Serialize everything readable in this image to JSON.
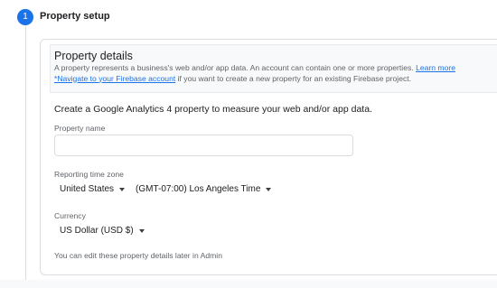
{
  "stepper": {
    "number": "1",
    "title": "Property setup"
  },
  "details": {
    "title": "Property details",
    "description": "A property represents a business's web and/or app data. An account can contain one or more properties.",
    "learn_more": "Learn more",
    "firebase_link": "*Navigate to your Firebase account",
    "firebase_text": " if you want to create a new property for an existing Firebase project."
  },
  "form": {
    "intro": "Create a Google Analytics 4 property to measure your web and/or app data.",
    "property_name_label": "Property name",
    "property_name_value": "",
    "timezone_label": "Reporting time zone",
    "country": "United States",
    "timezone": "(GMT-07:00) Los Angeles Time",
    "currency_label": "Currency",
    "currency": "US Dollar (USD $)",
    "note": "You can edit these property details later in Admin"
  }
}
